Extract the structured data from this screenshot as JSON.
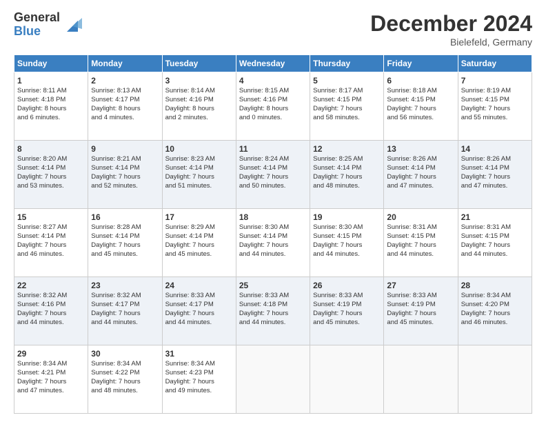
{
  "header": {
    "logo_general": "General",
    "logo_blue": "Blue",
    "title": "December 2024",
    "location": "Bielefeld, Germany"
  },
  "days_header": [
    "Sunday",
    "Monday",
    "Tuesday",
    "Wednesday",
    "Thursday",
    "Friday",
    "Saturday"
  ],
  "weeks": [
    [
      {
        "day": "1",
        "lines": [
          "Sunrise: 8:11 AM",
          "Sunset: 4:18 PM",
          "Daylight: 8 hours",
          "and 6 minutes."
        ]
      },
      {
        "day": "2",
        "lines": [
          "Sunrise: 8:13 AM",
          "Sunset: 4:17 PM",
          "Daylight: 8 hours",
          "and 4 minutes."
        ]
      },
      {
        "day": "3",
        "lines": [
          "Sunrise: 8:14 AM",
          "Sunset: 4:16 PM",
          "Daylight: 8 hours",
          "and 2 minutes."
        ]
      },
      {
        "day": "4",
        "lines": [
          "Sunrise: 8:15 AM",
          "Sunset: 4:16 PM",
          "Daylight: 8 hours",
          "and 0 minutes."
        ]
      },
      {
        "day": "5",
        "lines": [
          "Sunrise: 8:17 AM",
          "Sunset: 4:15 PM",
          "Daylight: 7 hours",
          "and 58 minutes."
        ]
      },
      {
        "day": "6",
        "lines": [
          "Sunrise: 8:18 AM",
          "Sunset: 4:15 PM",
          "Daylight: 7 hours",
          "and 56 minutes."
        ]
      },
      {
        "day": "7",
        "lines": [
          "Sunrise: 8:19 AM",
          "Sunset: 4:15 PM",
          "Daylight: 7 hours",
          "and 55 minutes."
        ]
      }
    ],
    [
      {
        "day": "8",
        "lines": [
          "Sunrise: 8:20 AM",
          "Sunset: 4:14 PM",
          "Daylight: 7 hours",
          "and 53 minutes."
        ]
      },
      {
        "day": "9",
        "lines": [
          "Sunrise: 8:21 AM",
          "Sunset: 4:14 PM",
          "Daylight: 7 hours",
          "and 52 minutes."
        ]
      },
      {
        "day": "10",
        "lines": [
          "Sunrise: 8:23 AM",
          "Sunset: 4:14 PM",
          "Daylight: 7 hours",
          "and 51 minutes."
        ]
      },
      {
        "day": "11",
        "lines": [
          "Sunrise: 8:24 AM",
          "Sunset: 4:14 PM",
          "Daylight: 7 hours",
          "and 50 minutes."
        ]
      },
      {
        "day": "12",
        "lines": [
          "Sunrise: 8:25 AM",
          "Sunset: 4:14 PM",
          "Daylight: 7 hours",
          "and 48 minutes."
        ]
      },
      {
        "day": "13",
        "lines": [
          "Sunrise: 8:26 AM",
          "Sunset: 4:14 PM",
          "Daylight: 7 hours",
          "and 47 minutes."
        ]
      },
      {
        "day": "14",
        "lines": [
          "Sunrise: 8:26 AM",
          "Sunset: 4:14 PM",
          "Daylight: 7 hours",
          "and 47 minutes."
        ]
      }
    ],
    [
      {
        "day": "15",
        "lines": [
          "Sunrise: 8:27 AM",
          "Sunset: 4:14 PM",
          "Daylight: 7 hours",
          "and 46 minutes."
        ]
      },
      {
        "day": "16",
        "lines": [
          "Sunrise: 8:28 AM",
          "Sunset: 4:14 PM",
          "Daylight: 7 hours",
          "and 45 minutes."
        ]
      },
      {
        "day": "17",
        "lines": [
          "Sunrise: 8:29 AM",
          "Sunset: 4:14 PM",
          "Daylight: 7 hours",
          "and 45 minutes."
        ]
      },
      {
        "day": "18",
        "lines": [
          "Sunrise: 8:30 AM",
          "Sunset: 4:14 PM",
          "Daylight: 7 hours",
          "and 44 minutes."
        ]
      },
      {
        "day": "19",
        "lines": [
          "Sunrise: 8:30 AM",
          "Sunset: 4:15 PM",
          "Daylight: 7 hours",
          "and 44 minutes."
        ]
      },
      {
        "day": "20",
        "lines": [
          "Sunrise: 8:31 AM",
          "Sunset: 4:15 PM",
          "Daylight: 7 hours",
          "and 44 minutes."
        ]
      },
      {
        "day": "21",
        "lines": [
          "Sunrise: 8:31 AM",
          "Sunset: 4:15 PM",
          "Daylight: 7 hours",
          "and 44 minutes."
        ]
      }
    ],
    [
      {
        "day": "22",
        "lines": [
          "Sunrise: 8:32 AM",
          "Sunset: 4:16 PM",
          "Daylight: 7 hours",
          "and 44 minutes."
        ]
      },
      {
        "day": "23",
        "lines": [
          "Sunrise: 8:32 AM",
          "Sunset: 4:17 PM",
          "Daylight: 7 hours",
          "and 44 minutes."
        ]
      },
      {
        "day": "24",
        "lines": [
          "Sunrise: 8:33 AM",
          "Sunset: 4:17 PM",
          "Daylight: 7 hours",
          "and 44 minutes."
        ]
      },
      {
        "day": "25",
        "lines": [
          "Sunrise: 8:33 AM",
          "Sunset: 4:18 PM",
          "Daylight: 7 hours",
          "and 44 minutes."
        ]
      },
      {
        "day": "26",
        "lines": [
          "Sunrise: 8:33 AM",
          "Sunset: 4:19 PM",
          "Daylight: 7 hours",
          "and 45 minutes."
        ]
      },
      {
        "day": "27",
        "lines": [
          "Sunrise: 8:33 AM",
          "Sunset: 4:19 PM",
          "Daylight: 7 hours",
          "and 45 minutes."
        ]
      },
      {
        "day": "28",
        "lines": [
          "Sunrise: 8:34 AM",
          "Sunset: 4:20 PM",
          "Daylight: 7 hours",
          "and 46 minutes."
        ]
      }
    ],
    [
      {
        "day": "29",
        "lines": [
          "Sunrise: 8:34 AM",
          "Sunset: 4:21 PM",
          "Daylight: 7 hours",
          "and 47 minutes."
        ]
      },
      {
        "day": "30",
        "lines": [
          "Sunrise: 8:34 AM",
          "Sunset: 4:22 PM",
          "Daylight: 7 hours",
          "and 48 minutes."
        ]
      },
      {
        "day": "31",
        "lines": [
          "Sunrise: 8:34 AM",
          "Sunset: 4:23 PM",
          "Daylight: 7 hours",
          "and 49 minutes."
        ]
      },
      null,
      null,
      null,
      null
    ]
  ]
}
